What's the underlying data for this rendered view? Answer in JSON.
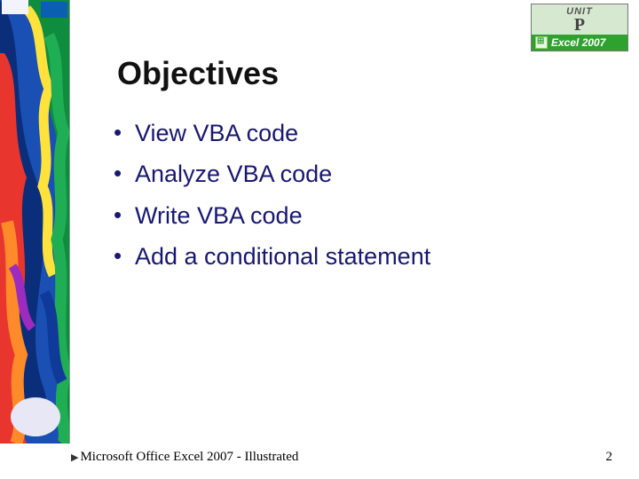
{
  "badge": {
    "unit_label": "UNIT",
    "unit_letter": "P",
    "product": "Excel 2007"
  },
  "title": "Objectives",
  "bullets": [
    "View VBA code",
    "Analyze VBA code",
    "Write VBA code",
    "Add a conditional statement"
  ],
  "footer": "Microsoft Office Excel 2007 - Illustrated",
  "page_number": "2"
}
